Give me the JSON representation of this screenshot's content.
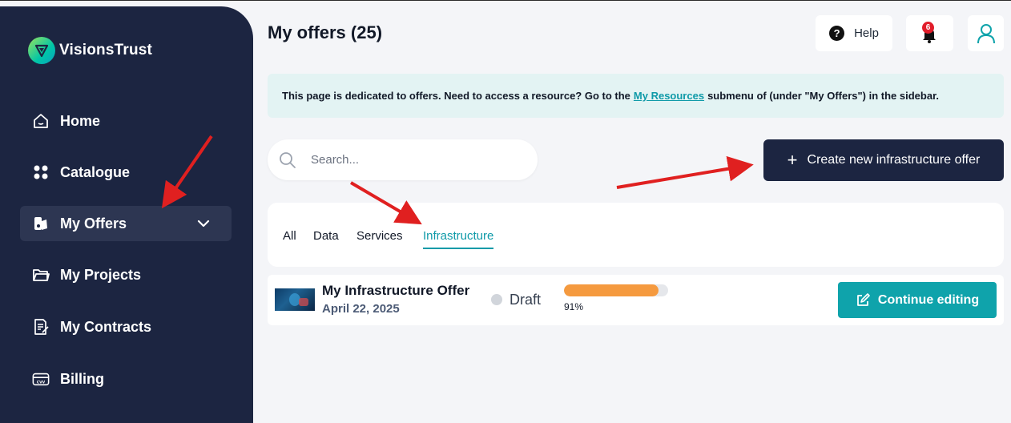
{
  "brand": {
    "name": "VisionsTrust"
  },
  "sidebar": {
    "items": [
      {
        "label": "Home",
        "icon": "home-icon"
      },
      {
        "label": "Catalogue",
        "icon": "grid-icon"
      },
      {
        "label": "My Offers",
        "icon": "offers-icon",
        "active": true,
        "expandable": true
      },
      {
        "label": "My Projects",
        "icon": "folder-icon"
      },
      {
        "label": "My Contracts",
        "icon": "contract-icon"
      },
      {
        "label": "Billing",
        "icon": "card-icon"
      }
    ]
  },
  "header": {
    "title": "My offers (25)",
    "help_label": "Help",
    "notification_count": "6"
  },
  "banner": {
    "text_before": "This page is dedicated to offers. Need to access a resource? Go to the",
    "link_text": "My Resources",
    "text_after": "submenu of (under \"My Offers\") in the sidebar."
  },
  "search": {
    "placeholder": "Search..."
  },
  "actions": {
    "create_label": "Create new infrastructure offer"
  },
  "tabs": [
    {
      "label": "All"
    },
    {
      "label": "Data"
    },
    {
      "label": "Services"
    },
    {
      "label": "Infrastructure",
      "active": true
    }
  ],
  "offers": [
    {
      "title": "My Infrastructure Offer",
      "date": "April 22, 2025",
      "status": "Draft",
      "progress": 91,
      "progress_label": "91%",
      "action_label": "Continue editing"
    }
  ],
  "colors": {
    "sidebar_bg": "#1c2541",
    "accent": "#0fa3ab",
    "progress": "#f59a3f",
    "annotation_arrow": "#e02020"
  }
}
